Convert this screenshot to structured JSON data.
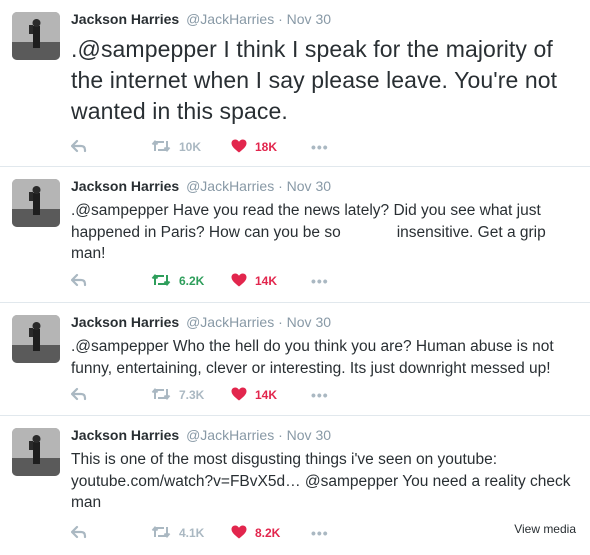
{
  "tweets": [
    {
      "name": "Jackson Harries",
      "handle": "@JackHarries",
      "dot": "·",
      "date": "Nov 30",
      "text": ".@sampepper I think I speak for the majority of the internet when I say please leave. You're not wanted in this space.",
      "retweets": "10K",
      "likes": "18K",
      "retweeted": false,
      "liked": true
    },
    {
      "name": "Jackson Harries",
      "handle": "@JackHarries",
      "dot": "·",
      "date": "Nov 30",
      "text": ".@sampepper Have you read the news lately? Did you see what just happened in Paris? How can you be so             insensitive. Get a grip man!",
      "retweets": "6.2K",
      "likes": "14K",
      "retweeted": true,
      "liked": true
    },
    {
      "name": "Jackson Harries",
      "handle": "@JackHarries",
      "dot": "·",
      "date": "Nov 30",
      "text": ".@sampepper Who the hell do you think you are? Human abuse is not funny, entertaining, clever or interesting. Its just downright messed up!",
      "retweets": "7.3K",
      "likes": "14K",
      "retweeted": false,
      "liked": true
    },
    {
      "name": "Jackson Harries",
      "handle": "@JackHarries",
      "dot": "·",
      "date": "Nov 30",
      "text": "This is one of the most disgusting things i've seen on youtube: youtube.com/watch?v=FBvX5d… @sampepper You need a reality check man",
      "retweets": "4.1K",
      "likes": "8.2K",
      "retweeted": false,
      "liked": true,
      "view_media": "View media"
    }
  ],
  "more_label": "•••",
  "icons": {
    "reply": "reply-icon",
    "retweet": "retweet-icon",
    "like": "heart-icon",
    "more": "more-icon"
  },
  "colors": {
    "name": "#292f33",
    "meta": "#8899a6",
    "icon_grey": "#aab8c2",
    "retweet_active": "#2e9e5b",
    "like_active": "#e2264d"
  }
}
